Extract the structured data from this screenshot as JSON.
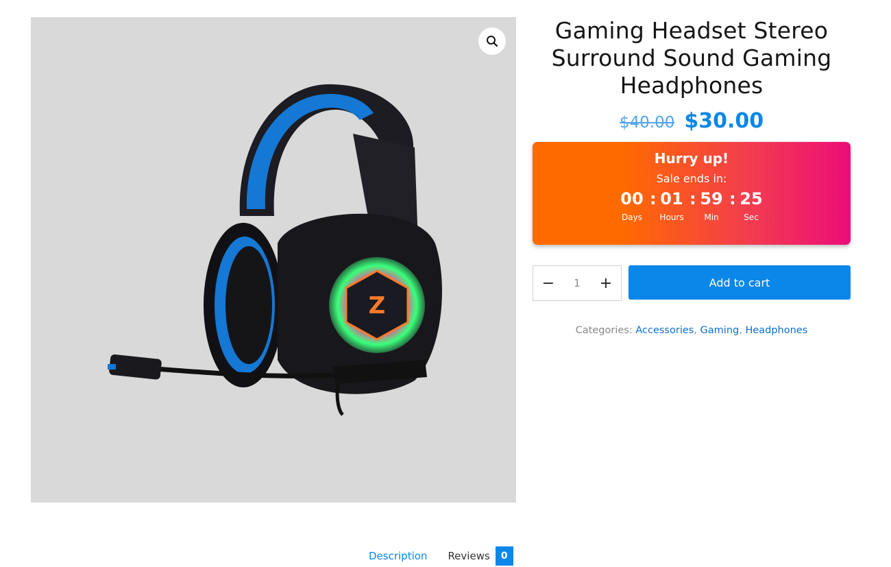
{
  "product": {
    "title": "Gaming Headset Stereo Surround Sound Gaming Headphones",
    "price_old": "$40.00",
    "price_new": "$30.00",
    "image_icon": "headset-image"
  },
  "gallery": {
    "zoom_icon": "magnifier-icon"
  },
  "countdown": {
    "title": "Hurry up!",
    "subtitle": "Sale ends in:",
    "days": "00",
    "hours": "01",
    "minutes": "59",
    "seconds": "25",
    "days_label": "Days",
    "hours_label": "Hours",
    "minutes_label": "Min",
    "seconds_label": "Sec",
    "separator": ":"
  },
  "cart": {
    "minus_label": "−",
    "plus_label": "+",
    "quantity": "1",
    "add_label": "Add to cart"
  },
  "categories": {
    "label": "Categories:",
    "items": [
      "Accessories",
      "Gaming",
      "Headphones"
    ]
  },
  "tabs": {
    "description": "Description",
    "reviews": "Reviews",
    "reviews_count": "0"
  },
  "colors": {
    "accent": "#0a87e8",
    "countdown_start": "#ff6a00",
    "countdown_end": "#ec0d78"
  }
}
